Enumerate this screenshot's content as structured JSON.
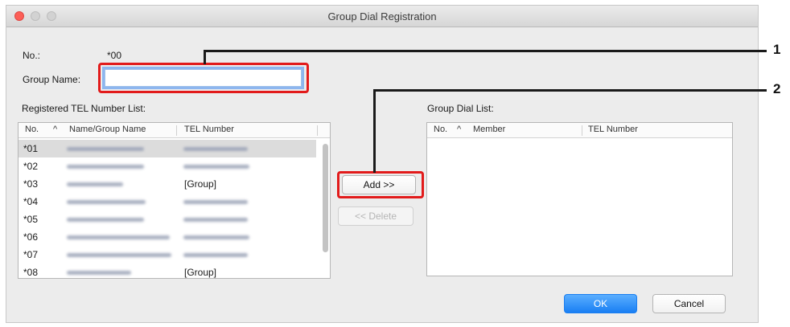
{
  "window": {
    "title": "Group Dial Registration"
  },
  "fields": {
    "no_label": "No.:",
    "no_value": "*00",
    "group_name_label": "Group Name:",
    "group_name_value": ""
  },
  "registered_list": {
    "title": "Registered TEL Number List:",
    "columns": [
      "No.",
      "^",
      "Name/Group Name",
      "TEL Number"
    ],
    "rows": [
      {
        "no": "*01",
        "tel": "",
        "selected": true
      },
      {
        "no": "*02",
        "tel": ""
      },
      {
        "no": "*03",
        "tel": "[Group]"
      },
      {
        "no": "*04",
        "tel": ""
      },
      {
        "no": "*05",
        "tel": ""
      },
      {
        "no": "*06",
        "tel": ""
      },
      {
        "no": "*07",
        "tel": ""
      },
      {
        "no": "*08",
        "tel": "[Group]"
      }
    ]
  },
  "group_dial_list": {
    "title": "Group Dial List:",
    "columns": [
      "No.",
      "^",
      "Member",
      "TEL Number"
    ]
  },
  "buttons": {
    "add": "Add >>",
    "delete": "<< Delete",
    "ok": "OK",
    "cancel": "Cancel"
  },
  "callouts": [
    "1",
    "2"
  ],
  "colors": {
    "highlight": "#e21b1b",
    "ok_button": "#1a7ff3",
    "close_button": "#fc5f57"
  }
}
